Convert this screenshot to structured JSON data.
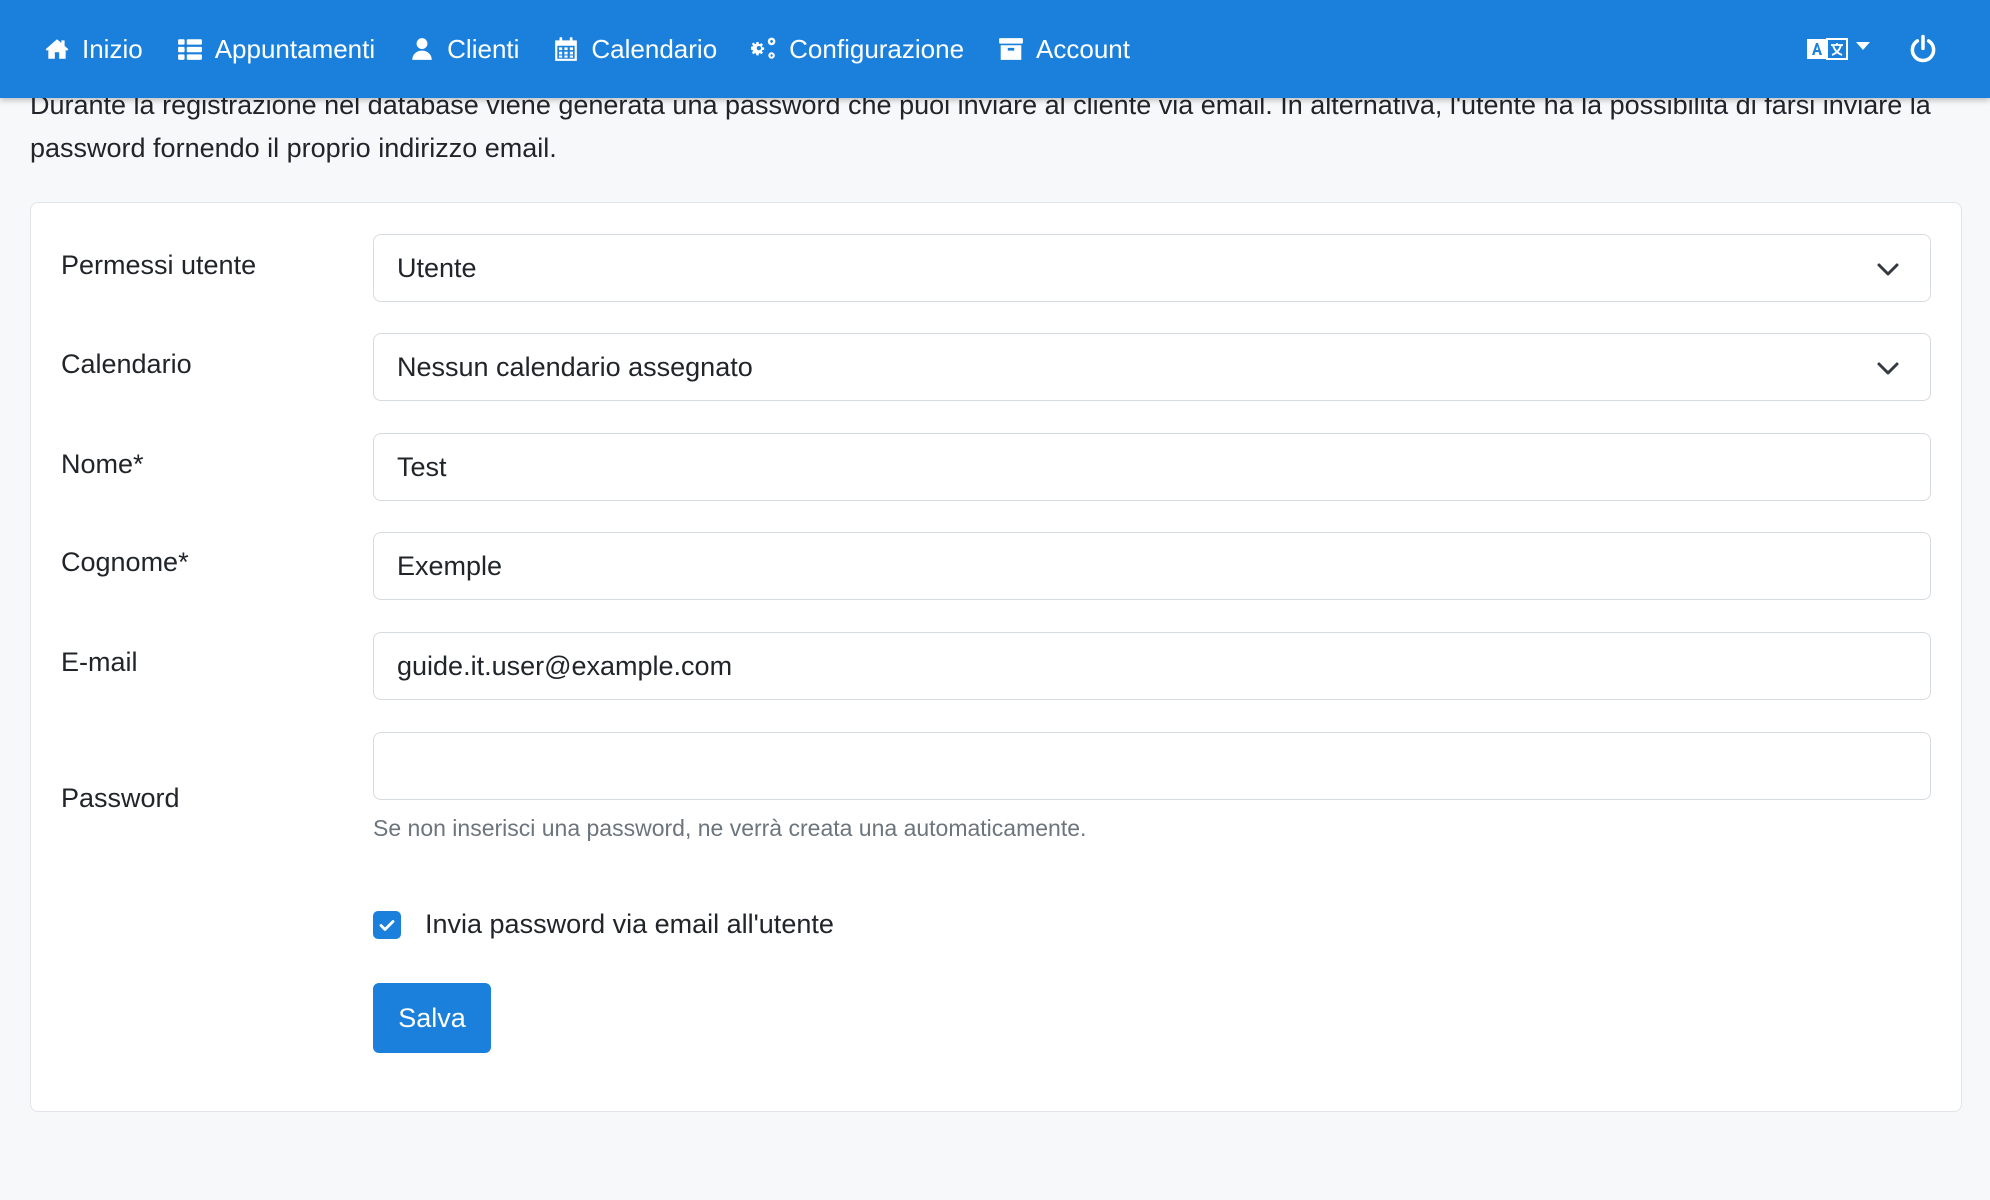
{
  "navbar": {
    "items": [
      {
        "label": "Inizio",
        "icon": "home-icon"
      },
      {
        "label": "Appuntamenti",
        "icon": "list-icon"
      },
      {
        "label": "Clienti",
        "icon": "user-icon"
      },
      {
        "label": "Calendario",
        "icon": "calendar-icon"
      },
      {
        "label": "Configurazione",
        "icon": "gears-icon"
      },
      {
        "label": "Account",
        "icon": "archive-icon"
      }
    ],
    "language_icon": "language-icon",
    "logout_icon": "power-icon"
  },
  "intro": {
    "text": "Durante la registrazione nel database viene generata una password che puoi inviare al cliente via email. In alternativa, l'utente ha la possibilità di farsi inviare la password fornendo il proprio indirizzo email."
  },
  "form": {
    "permissions": {
      "label": "Permessi utente",
      "value": "Utente"
    },
    "calendar": {
      "label": "Calendario",
      "value": "Nessun calendario assegnato"
    },
    "first_name": {
      "label": "Nome*",
      "value": "Test"
    },
    "last_name": {
      "label": "Cognome*",
      "value": "Exemple"
    },
    "email": {
      "label": "E-mail",
      "value": "guide.it.user@example.com"
    },
    "password": {
      "label": "Password",
      "value": "",
      "hint": "Se non inserisci una password, ne verrà creata una automaticamente."
    },
    "send_password": {
      "label": "Invia password via email all'utente",
      "checked": true
    },
    "save_label": "Salva"
  },
  "colors": {
    "primary": "#1a80dc",
    "background": "#f7f8fa",
    "text": "#212529",
    "muted": "#6c757d"
  }
}
